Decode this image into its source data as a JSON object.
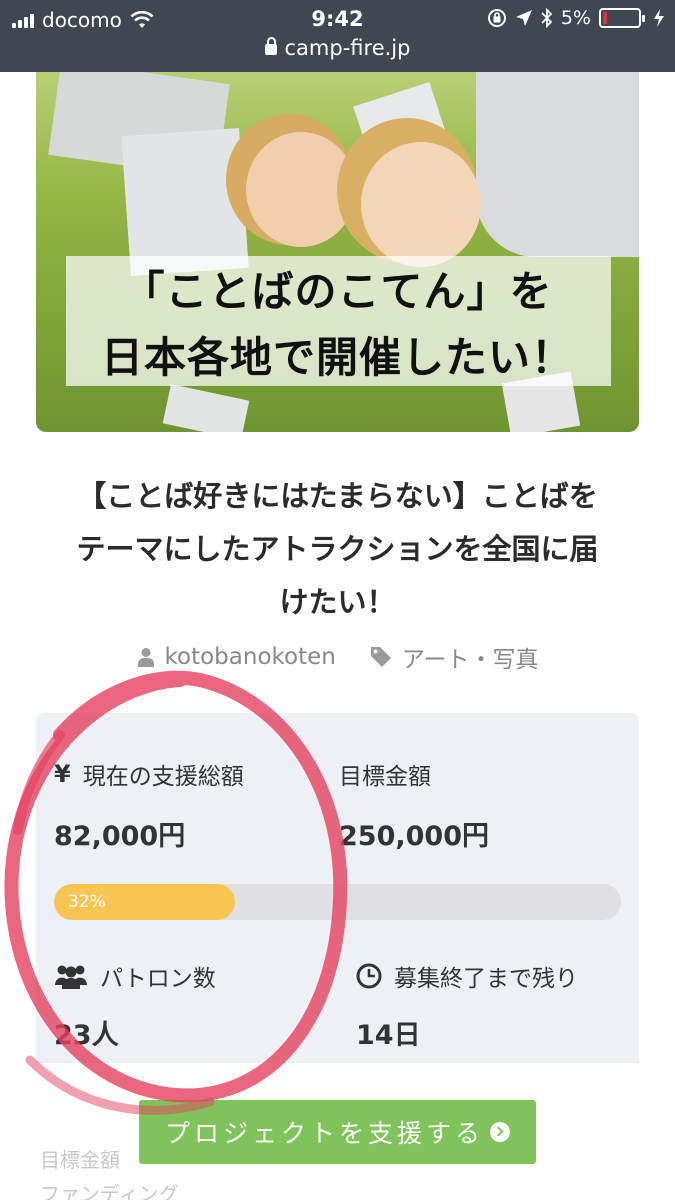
{
  "status_bar": {
    "carrier": "docomo",
    "time": "9:42",
    "battery": "5%"
  },
  "url_bar": {
    "domain": "camp-fire.jp"
  },
  "hero": {
    "line1": "「ことばのこてん」を",
    "line2": "日本各地で開催したい！"
  },
  "project": {
    "title_lines": [
      "【ことば好きにはたまらない】ことばを",
      "テーマにしたアトラクションを全国に届",
      "けたい！"
    ],
    "author": "kotobanokoten",
    "category": "アート・写真"
  },
  "stats": {
    "current_label": "現在の支援総額",
    "current_value": "82,000円",
    "goal_label": "目標金額",
    "goal_value": "250,000円",
    "progress_percent": 32,
    "progress_text": "32%",
    "patrons_label": "パトロン数",
    "patrons_value": "23人",
    "remaining_label": "募集終了まで残り",
    "remaining_value": "14日"
  },
  "cta": {
    "label": "プロジェクトを支援する"
  },
  "footer_peek": {
    "line1": "目標金額",
    "line2": "ファンディング"
  },
  "colors": {
    "topbar": "#3f4852",
    "stats_bg": "#edf1f6",
    "progress_fill": "#f6c552",
    "cta": "#7ec45a",
    "marker": "#e5415f"
  },
  "icons": [
    "signal-icon",
    "wifi-icon",
    "lock-icon",
    "rotation-lock-icon",
    "location-icon",
    "bluetooth-icon",
    "battery-icon",
    "charging-icon",
    "user-icon",
    "tag-icon",
    "yen-icon",
    "users-icon",
    "clock-icon",
    "arrow-right-circle-icon"
  ]
}
